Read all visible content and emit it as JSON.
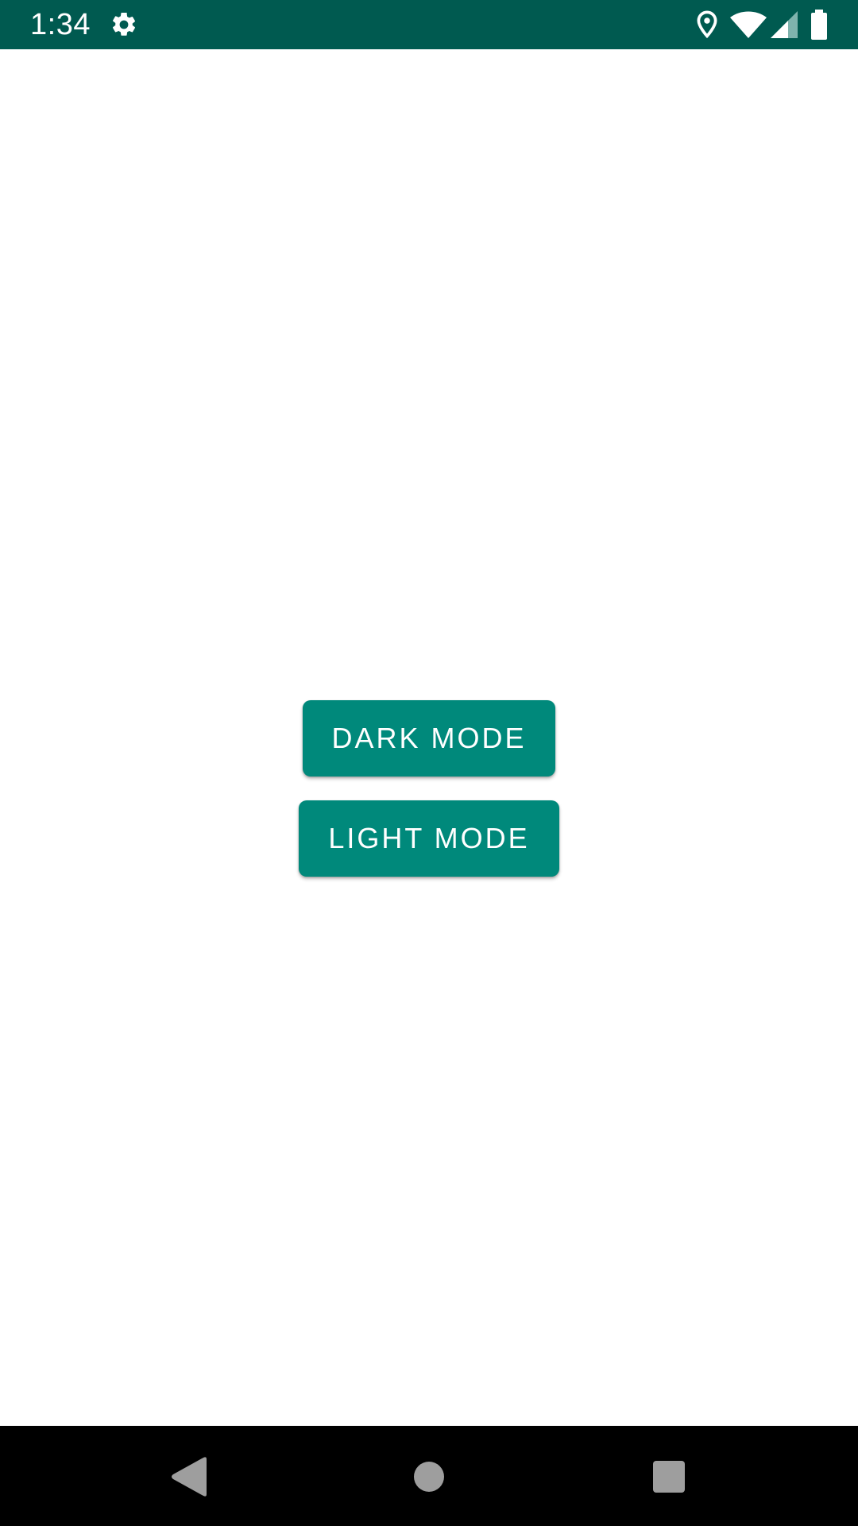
{
  "status_bar": {
    "time": "1:34",
    "background_color": "#005a50",
    "icons": [
      "gear-icon",
      "location-icon",
      "wifi-icon",
      "cell-signal-icon",
      "battery-icon"
    ]
  },
  "main": {
    "buttons": {
      "dark_mode": "DARK MODE",
      "light_mode": "LIGHT MODE"
    },
    "button_color": "#00897b"
  },
  "nav_bar": {
    "icons": [
      "back-icon",
      "home-icon",
      "recents-icon"
    ],
    "icon_color": "#9e9e9e"
  }
}
